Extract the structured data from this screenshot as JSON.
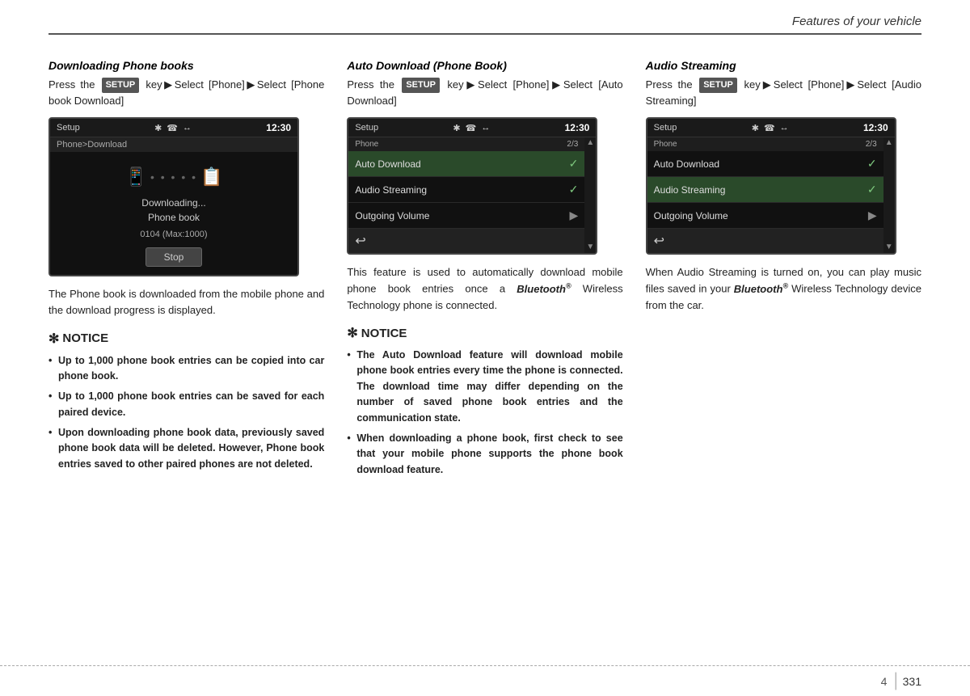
{
  "header": {
    "title": "Features of your vehicle"
  },
  "columns": [
    {
      "id": "col1",
      "section_title": "Downloading Phone books",
      "intro_parts": [
        "Press the",
        "SETUP",
        "key▶Select [Phone]▶Select [Phone book Download]"
      ],
      "screen": {
        "type": "large",
        "title_bar_left": "Setup",
        "title_bar_icons": [
          "bluetooth-icon",
          "phone-icon",
          "wifi-icon"
        ],
        "time": "12:30",
        "sub_bar": "Phone>Download",
        "download_label1": "Downloading...",
        "download_label2": "Phone book",
        "count": "0104 (Max:1000)",
        "stop_btn": "Stop"
      },
      "desc": "The Phone book is downloaded from the mobile phone and the download progress is displayed.",
      "notice_title": "✻ NOTICE",
      "notice_items": [
        "Up to 1,000 phone book entries can be copied into car phone book.",
        "Up to 1,000 phone book entries can be saved for each paired device.",
        "Upon downloading phone book data, previously saved phone book data will be deleted. However, Phone book entries saved to other paired phones are not deleted."
      ]
    },
    {
      "id": "col2",
      "section_title": "Auto Download (Phone Book)",
      "intro_parts": [
        "Press the",
        "SETUP",
        "key▶Select [Phone]▶Select [Auto Download]"
      ],
      "screen": {
        "type": "menu",
        "title_bar_left": "Setup",
        "title_bar_icons": [
          "bluetooth-icon",
          "phone-icon",
          "wifi-icon"
        ],
        "time": "12:30",
        "sub_bar_left": "Phone",
        "sub_bar_right": "2/3",
        "menu_items": [
          {
            "label": "Auto Download",
            "state": "check",
            "highlighted": true
          },
          {
            "label": "Audio Streaming",
            "state": "check",
            "highlighted": false
          },
          {
            "label": "Outgoing Volume",
            "state": "arrow",
            "highlighted": false
          }
        ]
      },
      "desc": "This feature is used to automatically download mobile phone book entries once a Bluetooth® Wireless Technology phone is connected.",
      "notice_title": "✻ NOTICE",
      "notice_items": [
        "The Auto Download feature will download mobile phone book entries every time the phone is connected. The download time may differ depending on the number of saved phone book entries and the communication state.",
        "When downloading a phone book, first check to see that your mobile phone supports the phone book download feature."
      ]
    },
    {
      "id": "col3",
      "section_title": "Audio Streaming",
      "intro_parts": [
        "Press the",
        "SETUP",
        "key▶Select [Phone]▶Select [Audio Streaming]"
      ],
      "screen": {
        "type": "menu",
        "title_bar_left": "Setup",
        "title_bar_icons": [
          "bluetooth-icon",
          "phone-icon",
          "wifi-icon"
        ],
        "time": "12:30",
        "sub_bar_left": "Phone",
        "sub_bar_right": "2/3",
        "menu_items": [
          {
            "label": "Auto Download",
            "state": "check",
            "highlighted": false
          },
          {
            "label": "Audio Streaming",
            "state": "check",
            "highlighted": true
          },
          {
            "label": "Outgoing Volume",
            "state": "arrow",
            "highlighted": false
          }
        ]
      },
      "desc": "When Audio Streaming is turned on, you can play music files saved in your Bluetooth® Wireless Technology device from the car.",
      "notice_title": null,
      "notice_items": []
    }
  ],
  "footer": {
    "page_section": "4",
    "page_number": "331"
  }
}
